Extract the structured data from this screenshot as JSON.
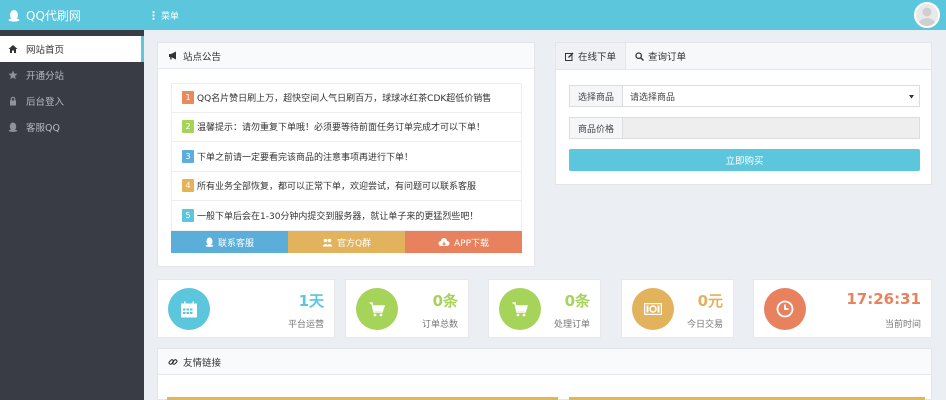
{
  "topbar": {
    "logo": "QQ代刷网",
    "menu": "菜单"
  },
  "sidebar": {
    "items": [
      {
        "label": "网站首页",
        "icon": "home-icon",
        "active": true
      },
      {
        "label": "开通分站",
        "icon": "star-icon",
        "active": false
      },
      {
        "label": "后台登入",
        "icon": "lock-icon",
        "active": false
      },
      {
        "label": "客服QQ",
        "icon": "qq-icon",
        "active": false
      }
    ]
  },
  "notice": {
    "title": "站点公告",
    "items": [
      {
        "num": "1",
        "text": "QQ名片赞日刷上万，超快空间人气日刷百万，球球冰红茶CDK超低价销售",
        "color": "#e98a5c"
      },
      {
        "num": "2",
        "text": "温馨提示：请勿重复下单哦！必须要等待前面任务订单完成才可以下单！",
        "color": "#a6d35a"
      },
      {
        "num": "3",
        "text": "下单之前请一定要看完该商品的注意事项再进行下单！",
        "color": "#5aaed9"
      },
      {
        "num": "4",
        "text": "所有业务全部恢复，都可以正常下单，欢迎尝试，有问题可以联系客服",
        "color": "#e6b256"
      },
      {
        "num": "5",
        "text": "一般下单后会在1-30分钟内提交到服务器，就让单子来的更猛烈些吧！",
        "color": "#5bc6dc"
      }
    ],
    "buttons": [
      {
        "label": "联系客服",
        "icon": "qq-icon",
        "color": "#5aaed9"
      },
      {
        "label": "官方Q群",
        "icon": "users-icon",
        "color": "#e2b25c"
      },
      {
        "label": "APP下载",
        "icon": "cloud-download-icon",
        "color": "#e8825e"
      }
    ]
  },
  "order": {
    "tabs": [
      {
        "label": "在线下单",
        "icon": "edit-icon"
      },
      {
        "label": "查询订单",
        "icon": "search-icon"
      }
    ],
    "product_label": "选择商品",
    "product_value": "请选择商品",
    "price_label": "商品价格",
    "price_value": "",
    "buy_label": "立即购买"
  },
  "stats": [
    {
      "value": "1天",
      "label": "平台运营",
      "color": "#5bc6dc",
      "icon": "calendar-icon"
    },
    {
      "value": "0条",
      "label": "订单总数",
      "color": "#a6d35a",
      "icon": "cart-icon"
    },
    {
      "value": "0条",
      "label": "处理订单",
      "color": "#a6d35a",
      "icon": "cart-icon"
    },
    {
      "value": "0元",
      "label": "今日交易",
      "color": "#e2b25c",
      "icon": "money-icon"
    },
    {
      "value": "17:26:31",
      "label": "当前时间",
      "color": "#e8825e",
      "icon": "clock-icon"
    }
  ],
  "links": {
    "title": "友情链接"
  }
}
